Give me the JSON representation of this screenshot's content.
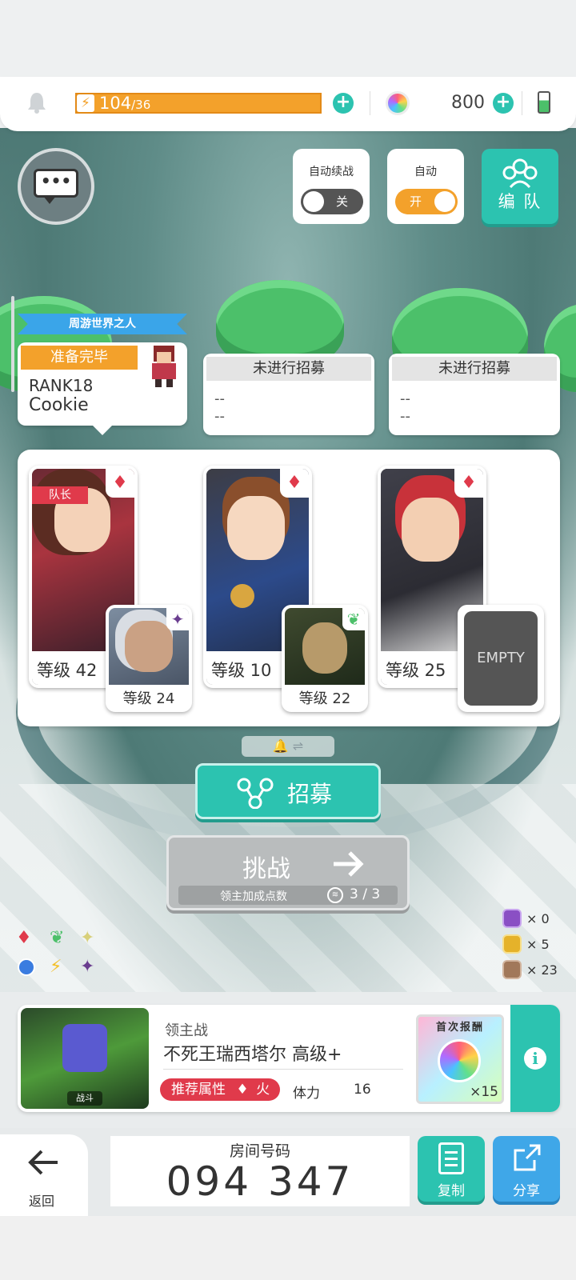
{
  "top_bar": {
    "stamina_current": "104",
    "stamina_max": "/36",
    "gems": "800"
  },
  "controls": {
    "auto_continue_label": "自动续战",
    "auto_continue_state": "关",
    "auto_label": "自动",
    "auto_state": "开",
    "team_label": "编 队"
  },
  "party": {
    "banner": "周游世界之人",
    "ready": "准备完毕",
    "rank": "RANK18",
    "player_name": "Cookie",
    "slots": [
      {
        "title": "未进行招募",
        "line1": "--",
        "line2": "--"
      },
      {
        "title": "未进行招募",
        "line1": "--",
        "line2": "--"
      }
    ]
  },
  "heroes": [
    {
      "level": "等级 42",
      "leader_tag": "队长",
      "sub_level": "等级 24",
      "element": "fire"
    },
    {
      "level": "等级 10",
      "sub_level": "等级 22",
      "element": "fire"
    },
    {
      "level": "等级 25",
      "sub_label": "EMPTY",
      "element": "fire"
    }
  ],
  "actions": {
    "recruit": "招募",
    "challenge": "挑战",
    "bonus_label": "领主加成点数",
    "bonus_value": "3 / 3"
  },
  "items": {
    "purple": "× 0",
    "gold": "× 5",
    "bronze": "× 23"
  },
  "boss": {
    "category": "领主战",
    "name": "不死王瑞西塔尔 高级+",
    "recommend_label": "推荐属性",
    "element": "火",
    "stamina_label": "体力",
    "stamina_cost": "16",
    "thumb_label": "战斗",
    "reward_title": "首次报酬",
    "reward_count": "×15"
  },
  "bottom": {
    "back_label": "返回",
    "room_label": "房间号码",
    "room_number": "094 347",
    "copy_label": "复制",
    "share_label": "分享"
  },
  "colors": {
    "teal": "#2cc3b0",
    "orange": "#f3a12b",
    "fire_red": "#e03a4b",
    "blue": "#3fa7e8"
  }
}
